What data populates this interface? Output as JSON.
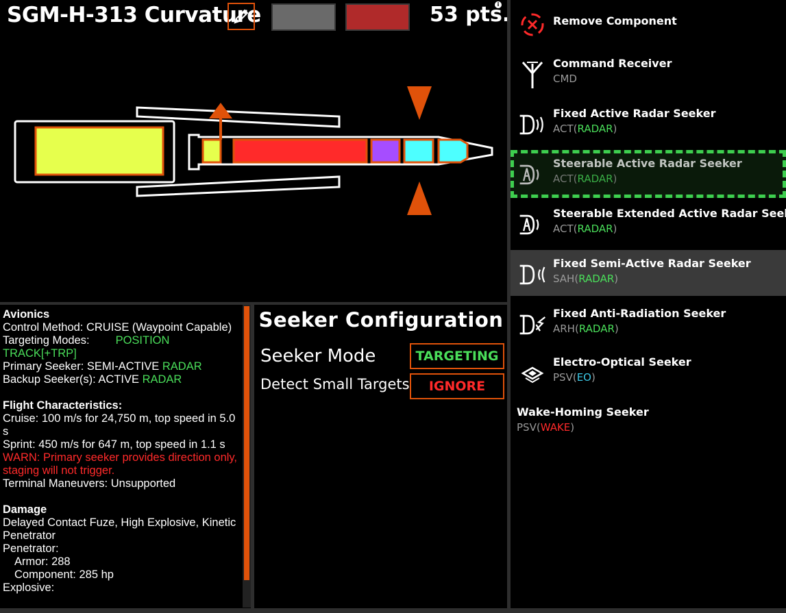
{
  "header": {
    "title": "SGM-H-313 Curvature",
    "points": "53 pts.",
    "info_glyph": "i",
    "swatch_colors": [
      "#6a6a6a",
      "#b02a2a"
    ]
  },
  "avionics": {
    "heading": "Avionics",
    "control_method": "Control Method: CRUISE (Waypoint Capable)",
    "targeting_label": "Targeting Modes:",
    "targeting_mode_1": "POSITION",
    "targeting_mode_2": "TRACK[+TRP]",
    "primary_prefix": "Primary Seeker: SEMI-ACTIVE ",
    "primary_type": "RADAR",
    "backup_prefix": "Backup Seeker(s): ACTIVE ",
    "backup_type": "RADAR"
  },
  "flight": {
    "heading": "Flight Characteristics:",
    "cruise": "Cruise: 100 m/s for 24,750 m, top speed in 5.0 s",
    "sprint": "Sprint: 450 m/s for 647 m, top speed in 1.1 s",
    "warn": "WARN: Primary seeker provides direction only, staging will not trigger.",
    "terminal": "Terminal Maneuvers: Unsupported"
  },
  "damage": {
    "heading": "Damage",
    "fuze": "Delayed Contact Fuze, High Explosive, Kinetic Penetrator",
    "penetrator": "Penetrator:",
    "armor": "Armor: 288",
    "component": "Component: 285 hp",
    "explosive": "Explosive:"
  },
  "seeker_config": {
    "title": "Seeker Configuration",
    "mode_label": "Seeker Mode",
    "mode_value": "TARGETING",
    "detect_label": "Detect Small Targets",
    "detect_value": "IGNORE"
  },
  "components": [
    {
      "name": "Remove Component",
      "code": "",
      "tag": "",
      "icon": "remove-icon"
    },
    {
      "name": "Command Receiver",
      "code": "CMD",
      "tag": "",
      "icon": "antenna-icon"
    },
    {
      "name": "Fixed Active Radar Seeker",
      "code": "ACT(",
      "tag": "RADAR",
      "icon": "active-radar-icon"
    },
    {
      "name": "Steerable Active Radar Seeker",
      "code": "ACT(",
      "tag": "RADAR",
      "icon": "steerable-radar-icon"
    },
    {
      "name": "Steerable Extended Active Radar Seeker",
      "code": "ACT(",
      "tag": "RADAR",
      "icon": "steerable-radar-icon"
    },
    {
      "name": "Fixed Semi-Active Radar Seeker",
      "code": "SAH(",
      "tag": "RADAR",
      "icon": "semi-active-radar-icon"
    },
    {
      "name": "Fixed Anti-Radiation Seeker",
      "code": "ARH(",
      "tag": "RADAR",
      "icon": "anti-radiation-icon"
    },
    {
      "name": "Electro-Optical Seeker",
      "code": "PSV(",
      "tag": "EO",
      "icon": "eye-icon"
    },
    {
      "name": "Wake-Homing Seeker",
      "code": "PSV(",
      "tag": "WAKE",
      "icon": ""
    }
  ],
  "colors": {
    "accent": "#e0520a",
    "green": "#4ade5a",
    "red": "#ff2a2a",
    "cyan": "#3cc8e6",
    "section_yellow": "#e6ff4d",
    "section_red": "#ff2a2a",
    "section_purple": "#a64dff",
    "section_cyan": "#4dffff"
  }
}
